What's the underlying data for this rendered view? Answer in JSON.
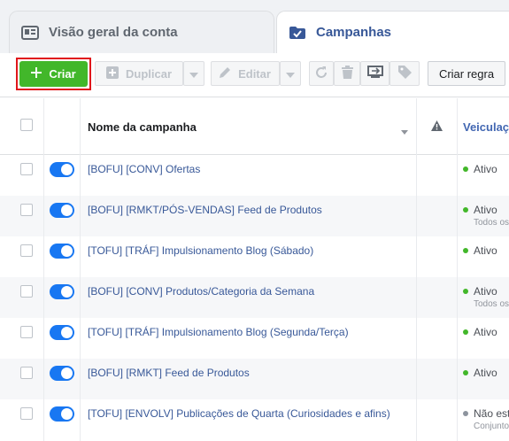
{
  "tabs": {
    "overview_label": "Visão geral da conta",
    "campaigns_label": "Campanhas"
  },
  "toolbar": {
    "create_label": "Criar",
    "duplicate_label": "Duplicar",
    "edit_label": "Editar",
    "create_rule_label": "Criar regra"
  },
  "table": {
    "headers": {
      "name": "Nome da campanha",
      "delivery": "Veiculação"
    },
    "rows": [
      {
        "name": "[BOFU] [CONV] Ofertas",
        "status": "Ativo",
        "sub": ""
      },
      {
        "name": "[BOFU] [RMKT/PÓS-VENDAS] Feed de Produtos",
        "status": "Ativo",
        "sub": "Todos os"
      },
      {
        "name": "[TOFU] [TRÁF] Impulsionamento Blog (Sábado)",
        "status": "Ativo",
        "sub": ""
      },
      {
        "name": "[BOFU] [CONV] Produtos/Categoria da Semana",
        "status": "Ativo",
        "sub": "Todos os"
      },
      {
        "name": "[TOFU] [TRÁF] Impulsionamento Blog (Segunda/Terça)",
        "status": "Ativo",
        "sub": ""
      },
      {
        "name": "[BOFU] [RMKT] Feed de Produtos",
        "status": "Ativo",
        "sub": ""
      },
      {
        "name": "[TOFU] [ENVOLV] Publicações de Quarta (Curiosidades e afins)",
        "status": "Não est",
        "sub": "Conjunto"
      }
    ]
  },
  "colors": {
    "create_green": "#42b72a",
    "highlight_red": "#e0161b",
    "toggle_blue": "#1877f2",
    "link_blue": "#385898",
    "status_active": "#42b72a",
    "status_inactive": "#8d949e"
  },
  "icons": [
    "account-overview-icon",
    "campaigns-folder-icon",
    "plus-icon",
    "duplicate-icon",
    "pencil-icon",
    "dropdown-caret-icon",
    "refresh-icon",
    "trash-icon",
    "ab-test-icon",
    "tag-icon",
    "sort-caret-icon",
    "warning-icon"
  ]
}
